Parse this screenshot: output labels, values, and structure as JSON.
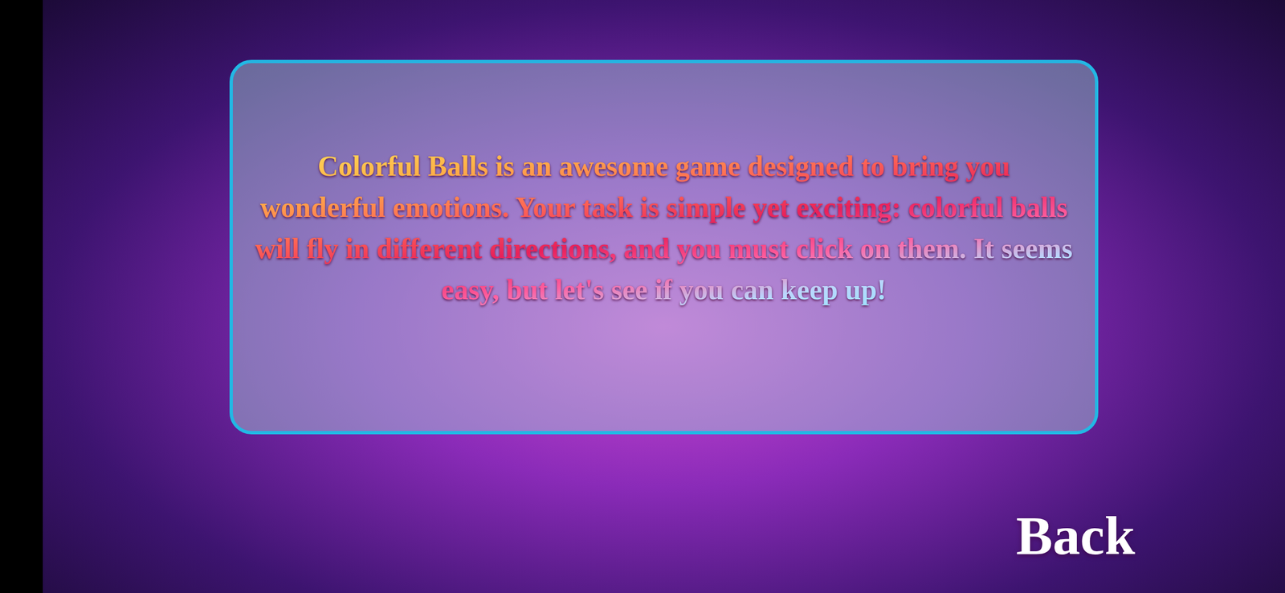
{
  "description": {
    "text": "Colorful Balls is an awesome game designed to bring you wonderful emotions. Your task is simple yet exciting: colorful balls will fly in different directions, and you must click on them. It seems easy, but let's see if you can keep up!"
  },
  "buttons": [
    {
      "label": "Back"
    }
  ]
}
